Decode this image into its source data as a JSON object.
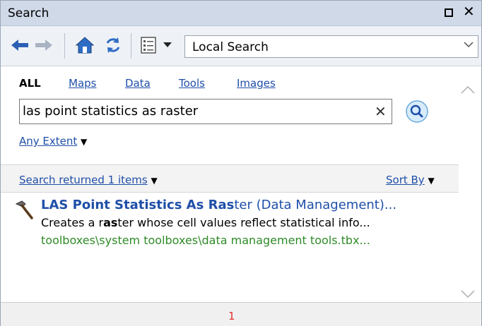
{
  "window": {
    "title": "Search"
  },
  "toolbar": {
    "source_value": "Local Search",
    "icons": [
      "back-arrow-icon",
      "forward-arrow-icon",
      "home-icon",
      "refresh-icon",
      "list-view-icon",
      "dropdown-arrow-icon"
    ]
  },
  "search": {
    "tabs": [
      {
        "label": "ALL",
        "active": true
      },
      {
        "label": "Maps"
      },
      {
        "label": "Data"
      },
      {
        "label": "Tools"
      },
      {
        "label": "Images"
      }
    ],
    "query": "las point statistics as raster",
    "extent_label": "Any Extent"
  },
  "results": {
    "summary": "Search returned 1 items",
    "sort_label": "Sort By",
    "items": [
      {
        "title_bold": "LAS Point Statistics As Ras",
        "title_rest": "ter (Data Management)...",
        "desc_pre": "Creates a r",
        "desc_bold": "as",
        "desc_post": "ter whose cell values reflect statistical info...",
        "path": "toolboxes\\system toolboxes\\data management tools.tbx..."
      }
    ]
  },
  "pager": {
    "page": "1"
  },
  "colors": {
    "link": "#1f4fa8",
    "path": "#2e8b27",
    "page_number": "#e03030",
    "titlebar": "#cfd9e8"
  }
}
